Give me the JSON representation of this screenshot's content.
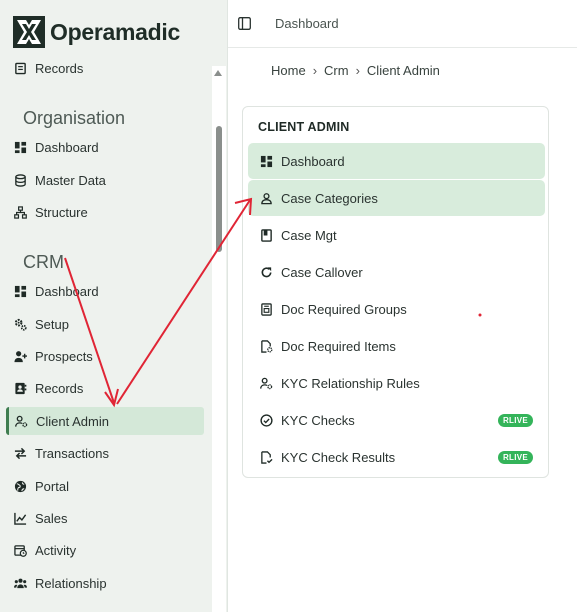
{
  "app": {
    "brand": "Operamadic"
  },
  "topbar": {
    "title": "Dashboard"
  },
  "breadcrumb": [
    "Home",
    "Crm",
    "Client Admin"
  ],
  "sidebar": {
    "partial_item": {
      "label": "Records",
      "icon": "records-icon"
    },
    "sections": [
      {
        "title": "Organisation",
        "items": [
          {
            "label": "Dashboard",
            "icon": "dashboard-icon"
          },
          {
            "label": "Master Data",
            "icon": "database-icon"
          },
          {
            "label": "Structure",
            "icon": "hierarchy-icon"
          }
        ]
      },
      {
        "title": "CRM",
        "items": [
          {
            "label": "Dashboard",
            "icon": "dashboard-icon"
          },
          {
            "label": "Setup",
            "icon": "cogs-icon"
          },
          {
            "label": "Prospects",
            "icon": "user-plus-icon"
          },
          {
            "label": "Records",
            "icon": "address-book-icon"
          },
          {
            "label": "Client Admin",
            "icon": "user-gear-icon",
            "active": true
          },
          {
            "label": "Transactions",
            "icon": "swap-icon"
          },
          {
            "label": "Portal",
            "icon": "globe-icon"
          },
          {
            "label": "Sales",
            "icon": "chart-line-icon"
          },
          {
            "label": "Activity",
            "icon": "calendar-clock-icon"
          },
          {
            "label": "Relationship",
            "icon": "users-icon"
          }
        ]
      }
    ]
  },
  "client_admin_card": {
    "title": "CLIENT ADMIN",
    "items": [
      {
        "label": "Dashboard",
        "icon": "dashboard-icon",
        "highlighted": true
      },
      {
        "label": "Case Categories",
        "icon": "user-icon",
        "highlighted": true
      },
      {
        "label": "Case Mgt",
        "icon": "book-icon"
      },
      {
        "label": "Case Callover",
        "icon": "refresh-icon"
      },
      {
        "label": "Doc Required Groups",
        "icon": "file-group-icon"
      },
      {
        "label": "Doc Required Items",
        "icon": "file-gear-icon"
      },
      {
        "label": "KYC Relationship Rules",
        "icon": "user-gear-icon"
      },
      {
        "label": "KYC Checks",
        "icon": "check-circle-icon",
        "badge": "RLIVE"
      },
      {
        "label": "KYC Check Results",
        "icon": "file-check-icon",
        "badge": "RLIVE"
      }
    ]
  },
  "colors": {
    "sidebar_bg": "#eef2ee",
    "active_bg": "#d4e8d8",
    "highlight_bg": "#d8ecdc",
    "badge_green": "#34b45a",
    "annotation_red": "#e02535"
  }
}
